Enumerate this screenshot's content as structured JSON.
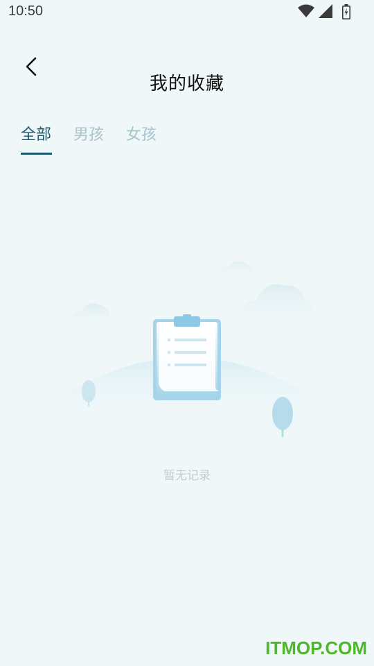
{
  "status_bar": {
    "time": "10:50",
    "icons": [
      "wifi-icon",
      "signal-icon",
      "battery-charging-icon"
    ]
  },
  "header": {
    "title": "我的收藏",
    "back_icon": "chevron-left-icon"
  },
  "tabs": [
    {
      "label": "全部",
      "active": true
    },
    {
      "label": "男孩",
      "active": false
    },
    {
      "label": "女孩",
      "active": false
    }
  ],
  "empty_state": {
    "illustration": "clipboard-illustration",
    "message": "暂无记录"
  },
  "watermark": "ITMOP.COM",
  "colors": {
    "background": "#eff7f9",
    "accent": "#1d5a6b",
    "inactive_tab": "#a9c4cb",
    "empty_text": "#c4cdd0",
    "watermark": "#4fb82a"
  }
}
